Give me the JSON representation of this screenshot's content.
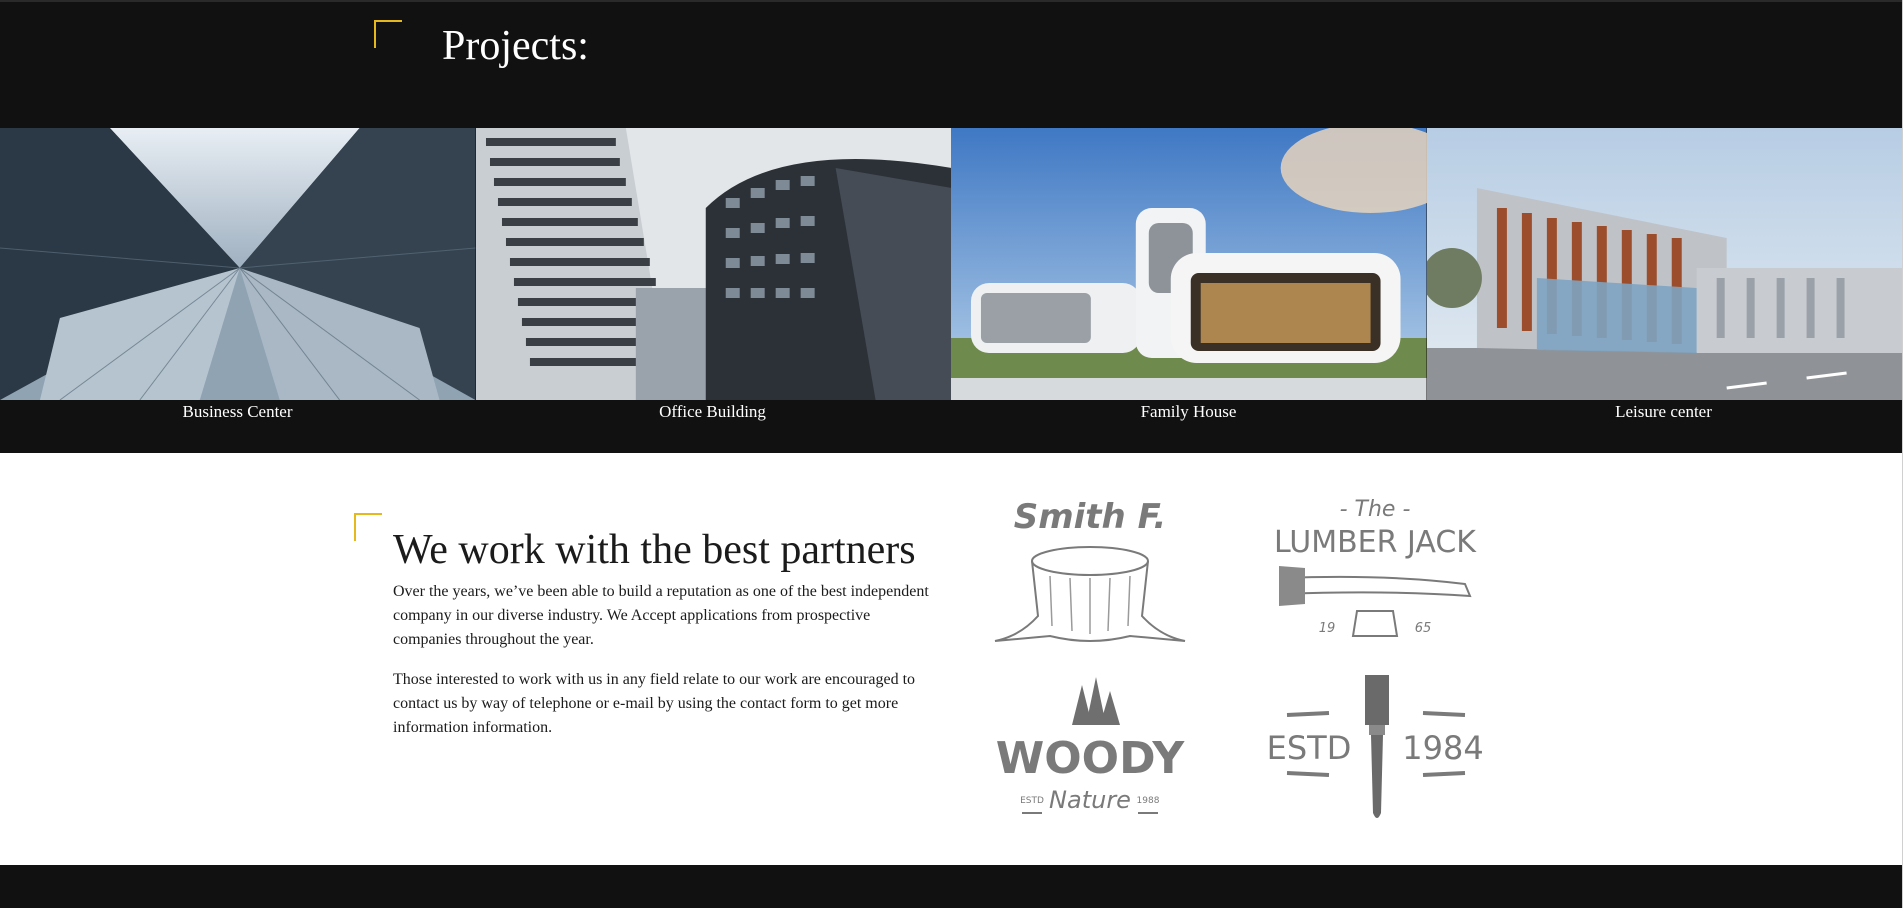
{
  "projects": {
    "title": "Projects:",
    "items": [
      {
        "caption": "Business Center"
      },
      {
        "caption": "Office Building"
      },
      {
        "caption": "Family House"
      },
      {
        "caption": "Leisure center"
      }
    ]
  },
  "partners": {
    "title": "We work with the best partners",
    "paragraph_1": "Over the years, we’ve been able to build a reputation as one of the best independent company in our diverse industry. We Accept applications from prospective companies throughout the year.",
    "paragraph_2": "Those interested to work with us in any field relate to our work are encouraged to contact us by way of telephone or e-mail by using the contact form to get more information information.",
    "logos": {
      "smith": {
        "name": "Smith F."
      },
      "lumber": {
        "top": "- The -",
        "name": "LUMBER JACK",
        "year_a": "19",
        "year_b": "65"
      },
      "woody": {
        "name": "WOODY",
        "sub": "Nature",
        "estd": "ESTD",
        "year": "1988"
      },
      "estd": {
        "left": "ESTD",
        "right": "1984"
      }
    }
  },
  "colors": {
    "accent": "#e5b81c",
    "dark_bg": "#111111",
    "logo_gray": "#7a7a7a"
  }
}
